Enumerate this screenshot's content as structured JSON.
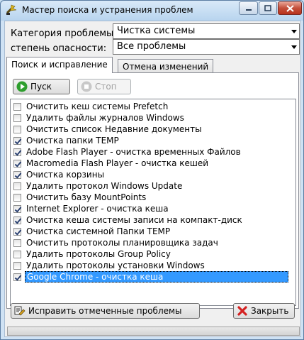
{
  "window": {
    "title": "Мастер поиска и устранения проблем",
    "icon": "wizard-wand-icon",
    "controls": [
      "minimize-icon",
      "maximize-icon",
      "close-icon"
    ]
  },
  "filters": {
    "category_label": "Категория проблемы:",
    "category_value": "Чистка системы",
    "severity_label": "степень опасности:",
    "severity_value": "Все проблемы"
  },
  "tabs": [
    {
      "label": "Поиск и исправление",
      "active": true
    },
    {
      "label": "Отмена изменений",
      "active": false
    }
  ],
  "toolbar": {
    "start_label": "Пуск",
    "stop_label": "Стоп"
  },
  "items": [
    {
      "label": "Очистить кеш системы Prefetch",
      "checked": false
    },
    {
      "label": "Удалить файлы журналов Windows",
      "checked": false
    },
    {
      "label": "Очистить список Недавние документы",
      "checked": false
    },
    {
      "label": "Очистка папки TEMP",
      "checked": true
    },
    {
      "label": "Adobe Flash Player - очистка временных Файлов",
      "checked": true
    },
    {
      "label": "Macromedia Flash Player - очистка кешей",
      "checked": true
    },
    {
      "label": "Очистка корзины",
      "checked": true
    },
    {
      "label": "Удалить протокол Windows Update",
      "checked": false
    },
    {
      "label": "Очистить базу MountPoints",
      "checked": false
    },
    {
      "label": "Internet Explorer - очистка кеша",
      "checked": true
    },
    {
      "label": "Очистка кеша системы записи на компакт-диск",
      "checked": true
    },
    {
      "label": "Очистка системной Папки TEMP",
      "checked": true
    },
    {
      "label": "Очистить протоколы планировщика задач",
      "checked": false
    },
    {
      "label": "Удалить протоколы Group Policy",
      "checked": false
    },
    {
      "label": "Удалить протоколы установки Windows",
      "checked": false
    },
    {
      "label": "Google Chrome - очистка кеша",
      "checked": true,
      "selected": true
    }
  ],
  "footer": {
    "fix_label": "Исправить отмеченные проблемы",
    "close_label": "Закрыть"
  },
  "colors": {
    "selection": "#3399ff",
    "start_icon": "#2e9e2e",
    "close_icon": "#d42020"
  }
}
